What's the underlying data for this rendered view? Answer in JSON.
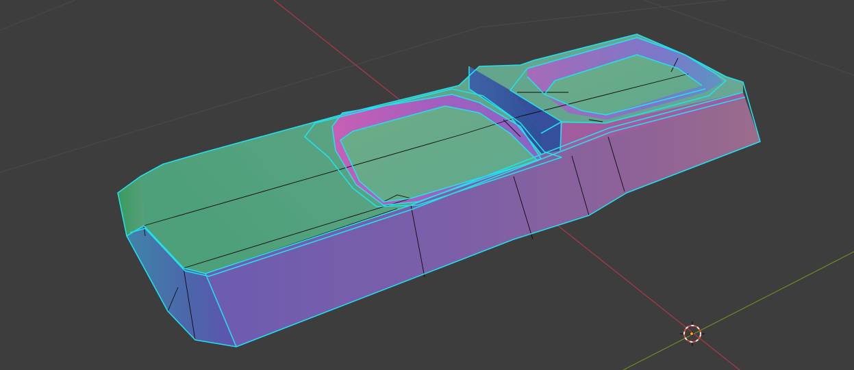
{
  "app": "3D viewport",
  "colors": {
    "background": "#3d3d3d",
    "grid": "#4a4a4a",
    "x_axis": "#b03a48",
    "y_axis": "#6b8e23",
    "selection_outline": "#22e0ee",
    "mesh_edge": "#0a0a0a",
    "cursor_ring_red": "#e24a3a",
    "cursor_ring_white": "#f0f0f0",
    "origin_dot": "#ff9a1f"
  },
  "viewport": {
    "mode": "edit-mode",
    "shading": "normal-map-colors",
    "object": "selected-mesh",
    "cursor_icon": "3d-cursor-icon",
    "origin_icon": "object-origin-icon"
  }
}
